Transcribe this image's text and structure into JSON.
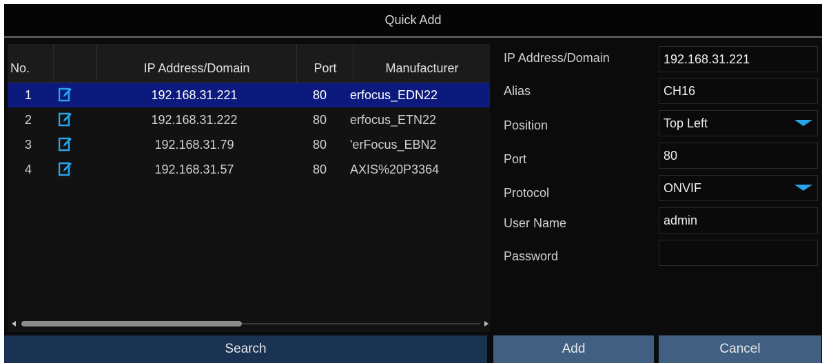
{
  "dialog": {
    "title": "Quick Add"
  },
  "table": {
    "headers": {
      "no": "No.",
      "edit": "",
      "ip": "IP Address/Domain",
      "port": "Port",
      "manufacturer": "Manufacturer"
    },
    "rows": [
      {
        "no": "1",
        "ip": "192.168.31.221",
        "port": "80",
        "manufacturer": "erfocus_EDN22",
        "selected": true
      },
      {
        "no": "2",
        "ip": "192.168.31.222",
        "port": "80",
        "manufacturer": "erfocus_ETN22",
        "selected": false
      },
      {
        "no": "3",
        "ip": "192.168.31.79",
        "port": "80",
        "manufacturer": "'erFocus_EBN2",
        "selected": false
      },
      {
        "no": "4",
        "ip": "192.168.31.57",
        "port": "80",
        "manufacturer": "AXIS%20P3364",
        "selected": false
      }
    ],
    "edit_icon": "edit-icon",
    "scrollbar_position": 0.45
  },
  "form": {
    "ip_label": "IP Address/Domain",
    "ip_value": "192.168.31.221",
    "alias_label": "Alias",
    "alias_value": "CH16",
    "position_label": "Position",
    "position_value": "Top Left",
    "port_label": "Port",
    "port_value": "80",
    "protocol_label": "Protocol",
    "protocol_value": "ONVIF",
    "username_label": "User Name",
    "username_value": "admin",
    "password_label": "Password",
    "password_value": ""
  },
  "buttons": {
    "search": "Search",
    "add": "Add",
    "cancel": "Cancel"
  },
  "colors": {
    "selected_row": "#0c1a7e",
    "icon_blue": "#29a3ea",
    "button": "#405f81",
    "search_button": "#1a3352"
  }
}
